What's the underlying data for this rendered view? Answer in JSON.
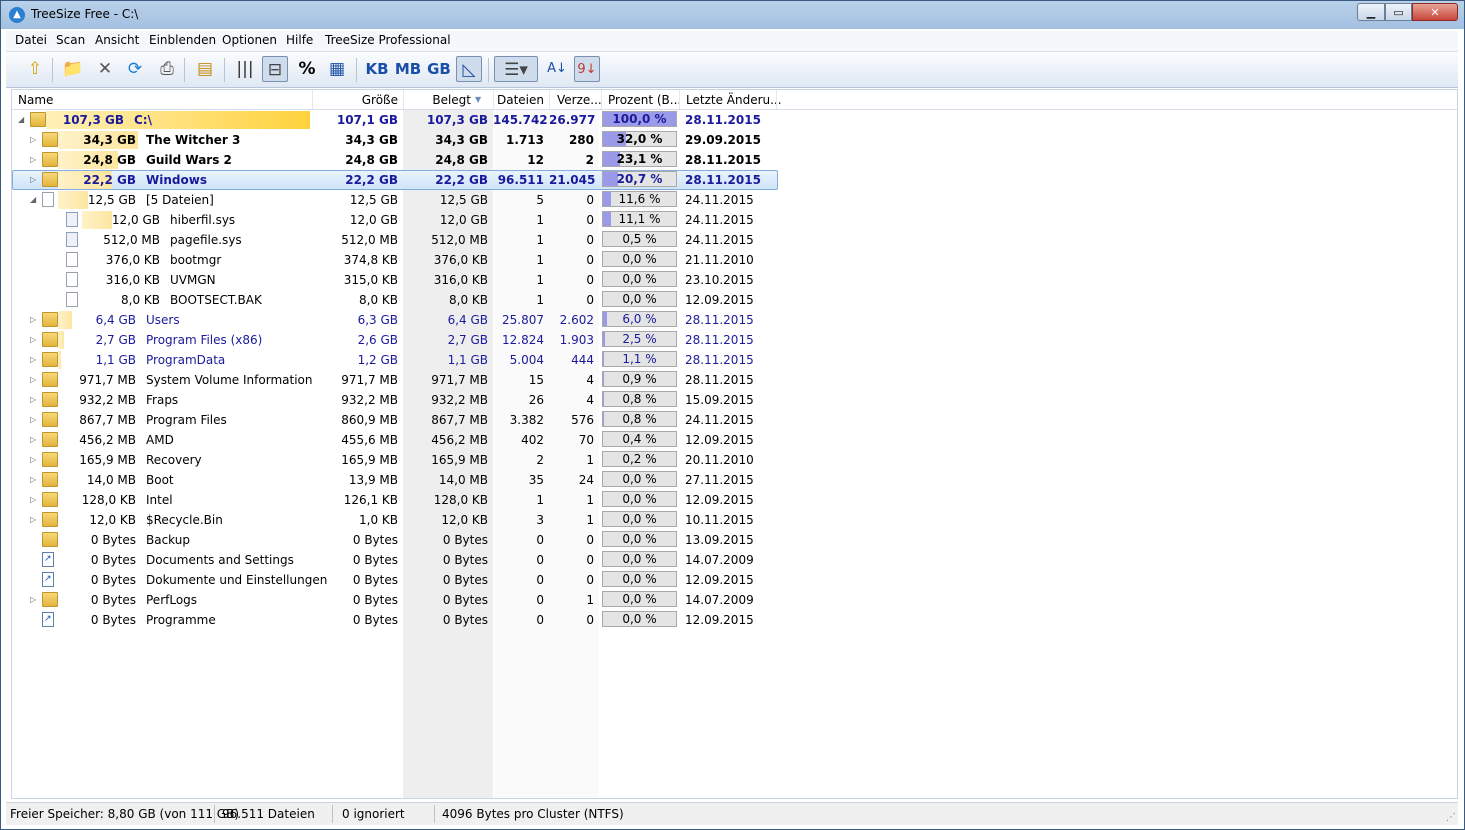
{
  "window": {
    "title": "TreeSize Free - C:\\"
  },
  "menu": [
    "Datei",
    "Scan",
    "Ansicht",
    "Einblenden",
    "Optionen",
    "Hilfe",
    "TreeSize Professional"
  ],
  "toolbar": {
    "unit_kb": "KB",
    "unit_mb": "MB",
    "unit_gb": "GB",
    "percent": "%"
  },
  "columns": {
    "name": "Name",
    "groesse": "Größe",
    "belegt": "Belegt",
    "dateien": "Dateien",
    "verzeichnisse": "Verze...",
    "prozent": "Prozent (B...",
    "letzte": "Letzte Änderu..."
  },
  "rows": [
    {
      "size_label": "107,3 GB",
      "name": "C:\\",
      "groesse": "107,1 GB",
      "belegt": "107,3 GB",
      "dateien": "145.742",
      "verz": "26.977",
      "pct_text": "100,0 %",
      "pct": 100.0,
      "date": "28.11.2015"
    },
    {
      "size_label": "34,3 GB",
      "name": "The Witcher 3",
      "groesse": "34,3 GB",
      "belegt": "34,3 GB",
      "dateien": "1.713",
      "verz": "280",
      "pct_text": "32,0 %",
      "pct": 32.0,
      "date": "29.09.2015"
    },
    {
      "size_label": "24,8 GB",
      "name": "Guild Wars 2",
      "groesse": "24,8 GB",
      "belegt": "24,8 GB",
      "dateien": "12",
      "verz": "2",
      "pct_text": "23,1 %",
      "pct": 23.1,
      "date": "28.11.2015"
    },
    {
      "size_label": "22,2 GB",
      "name": "Windows",
      "groesse": "22,2 GB",
      "belegt": "22,2 GB",
      "dateien": "96.511",
      "verz": "21.045",
      "pct_text": "20,7 %",
      "pct": 20.7,
      "date": "28.11.2015"
    },
    {
      "size_label": "12,5 GB",
      "name": "[5 Dateien]",
      "groesse": "12,5 GB",
      "belegt": "12,5 GB",
      "dateien": "5",
      "verz": "0",
      "pct_text": "11,6 %",
      "pct": 11.6,
      "date": "24.11.2015"
    },
    {
      "size_label": "12,0 GB",
      "name": "hiberfil.sys",
      "groesse": "12,0 GB",
      "belegt": "12,0 GB",
      "dateien": "1",
      "verz": "0",
      "pct_text": "11,1 %",
      "pct": 11.1,
      "date": "24.11.2015"
    },
    {
      "size_label": "512,0 MB",
      "name": "pagefile.sys",
      "groesse": "512,0 MB",
      "belegt": "512,0 MB",
      "dateien": "1",
      "verz": "0",
      "pct_text": "0,5 %",
      "pct": 0.5,
      "date": "24.11.2015"
    },
    {
      "size_label": "376,0 KB",
      "name": "bootmgr",
      "groesse": "374,8 KB",
      "belegt": "376,0 KB",
      "dateien": "1",
      "verz": "0",
      "pct_text": "0,0 %",
      "pct": 0.0,
      "date": "21.11.2010"
    },
    {
      "size_label": "316,0 KB",
      "name": "UVMGN",
      "groesse": "315,0 KB",
      "belegt": "316,0 KB",
      "dateien": "1",
      "verz": "0",
      "pct_text": "0,0 %",
      "pct": 0.0,
      "date": "23.10.2015"
    },
    {
      "size_label": "8,0 KB",
      "name": "BOOTSECT.BAK",
      "groesse": "8,0 KB",
      "belegt": "8,0 KB",
      "dateien": "1",
      "verz": "0",
      "pct_text": "0,0 %",
      "pct": 0.0,
      "date": "12.09.2015"
    },
    {
      "size_label": "6,4 GB",
      "name": "Users",
      "groesse": "6,3 GB",
      "belegt": "6,4 GB",
      "dateien": "25.807",
      "verz": "2.602",
      "pct_text": "6,0 %",
      "pct": 6.0,
      "date": "28.11.2015"
    },
    {
      "size_label": "2,7 GB",
      "name": "Program Files (x86)",
      "groesse": "2,6 GB",
      "belegt": "2,7 GB",
      "dateien": "12.824",
      "verz": "1.903",
      "pct_text": "2,5 %",
      "pct": 2.5,
      "date": "28.11.2015"
    },
    {
      "size_label": "1,1 GB",
      "name": "ProgramData",
      "groesse": "1,2 GB",
      "belegt": "1,1 GB",
      "dateien": "5.004",
      "verz": "444",
      "pct_text": "1,1 %",
      "pct": 1.1,
      "date": "28.11.2015"
    },
    {
      "size_label": "971,7 MB",
      "name": "System Volume Information",
      "groesse": "971,7 MB",
      "belegt": "971,7 MB",
      "dateien": "15",
      "verz": "4",
      "pct_text": "0,9 %",
      "pct": 0.9,
      "date": "28.11.2015"
    },
    {
      "size_label": "932,2 MB",
      "name": "Fraps",
      "groesse": "932,2 MB",
      "belegt": "932,2 MB",
      "dateien": "26",
      "verz": "4",
      "pct_text": "0,8 %",
      "pct": 0.8,
      "date": "15.09.2015"
    },
    {
      "size_label": "867,7 MB",
      "name": "Program Files",
      "groesse": "860,9 MB",
      "belegt": "867,7 MB",
      "dateien": "3.382",
      "verz": "576",
      "pct_text": "0,8 %",
      "pct": 0.8,
      "date": "24.11.2015"
    },
    {
      "size_label": "456,2 MB",
      "name": "AMD",
      "groesse": "455,6 MB",
      "belegt": "456,2 MB",
      "dateien": "402",
      "verz": "70",
      "pct_text": "0,4 %",
      "pct": 0.4,
      "date": "12.09.2015"
    },
    {
      "size_label": "165,9 MB",
      "name": "Recovery",
      "groesse": "165,9 MB",
      "belegt": "165,9 MB",
      "dateien": "2",
      "verz": "1",
      "pct_text": "0,2 %",
      "pct": 0.2,
      "date": "20.11.2010"
    },
    {
      "size_label": "14,0 MB",
      "name": "Boot",
      "groesse": "13,9 MB",
      "belegt": "14,0 MB",
      "dateien": "35",
      "verz": "24",
      "pct_text": "0,0 %",
      "pct": 0.0,
      "date": "27.11.2015"
    },
    {
      "size_label": "128,0 KB",
      "name": "Intel",
      "groesse": "126,1 KB",
      "belegt": "128,0 KB",
      "dateien": "1",
      "verz": "1",
      "pct_text": "0,0 %",
      "pct": 0.0,
      "date": "12.09.2015"
    },
    {
      "size_label": "12,0 KB",
      "name": "$Recycle.Bin",
      "groesse": "1,0 KB",
      "belegt": "12,0 KB",
      "dateien": "3",
      "verz": "1",
      "pct_text": "0,0 %",
      "pct": 0.0,
      "date": "10.11.2015"
    },
    {
      "size_label": "0 Bytes",
      "name": "Backup",
      "groesse": "0 Bytes",
      "belegt": "0 Bytes",
      "dateien": "0",
      "verz": "0",
      "pct_text": "0,0 %",
      "pct": 0.0,
      "date": "13.09.2015"
    },
    {
      "size_label": "0 Bytes",
      "name": "Documents and Settings",
      "groesse": "0 Bytes",
      "belegt": "0 Bytes",
      "dateien": "0",
      "verz": "0",
      "pct_text": "0,0 %",
      "pct": 0.0,
      "date": "14.07.2009"
    },
    {
      "size_label": "0 Bytes",
      "name": "Dokumente und Einstellungen",
      "groesse": "0 Bytes",
      "belegt": "0 Bytes",
      "dateien": "0",
      "verz": "0",
      "pct_text": "0,0 %",
      "pct": 0.0,
      "date": "12.09.2015"
    },
    {
      "size_label": "0 Bytes",
      "name": "PerfLogs",
      "groesse": "0 Bytes",
      "belegt": "0 Bytes",
      "dateien": "0",
      "verz": "1",
      "pct_text": "0,0 %",
      "pct": 0.0,
      "date": "14.07.2009"
    },
    {
      "size_label": "0 Bytes",
      "name": "Programme",
      "groesse": "0 Bytes",
      "belegt": "0 Bytes",
      "dateien": "0",
      "verz": "0",
      "pct_text": "0,0 %",
      "pct": 0.0,
      "date": "12.09.2015"
    }
  ],
  "status": {
    "free": "Freier Speicher: 8,80 GB  (von 111 GB)",
    "files": "96.511  Dateien",
    "ignored": "0 ignoriert",
    "cluster": "4096  Bytes pro Cluster (NTFS)"
  }
}
